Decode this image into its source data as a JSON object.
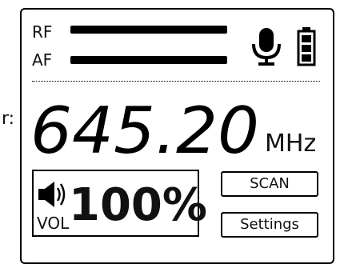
{
  "side_mark": "r:",
  "meters": {
    "rf": {
      "label": "RF",
      "level": 1.0
    },
    "af": {
      "label": "AF",
      "level": 1.0
    }
  },
  "icons": {
    "mic": "microphone-icon",
    "battery": "battery-full-icon",
    "speaker": "speaker-volume-icon"
  },
  "frequency": {
    "value": "645.20",
    "unit": "MHz"
  },
  "volume": {
    "label": "VOL",
    "value": "100%"
  },
  "buttons": {
    "scan": "SCAN",
    "settings": "Settings"
  }
}
